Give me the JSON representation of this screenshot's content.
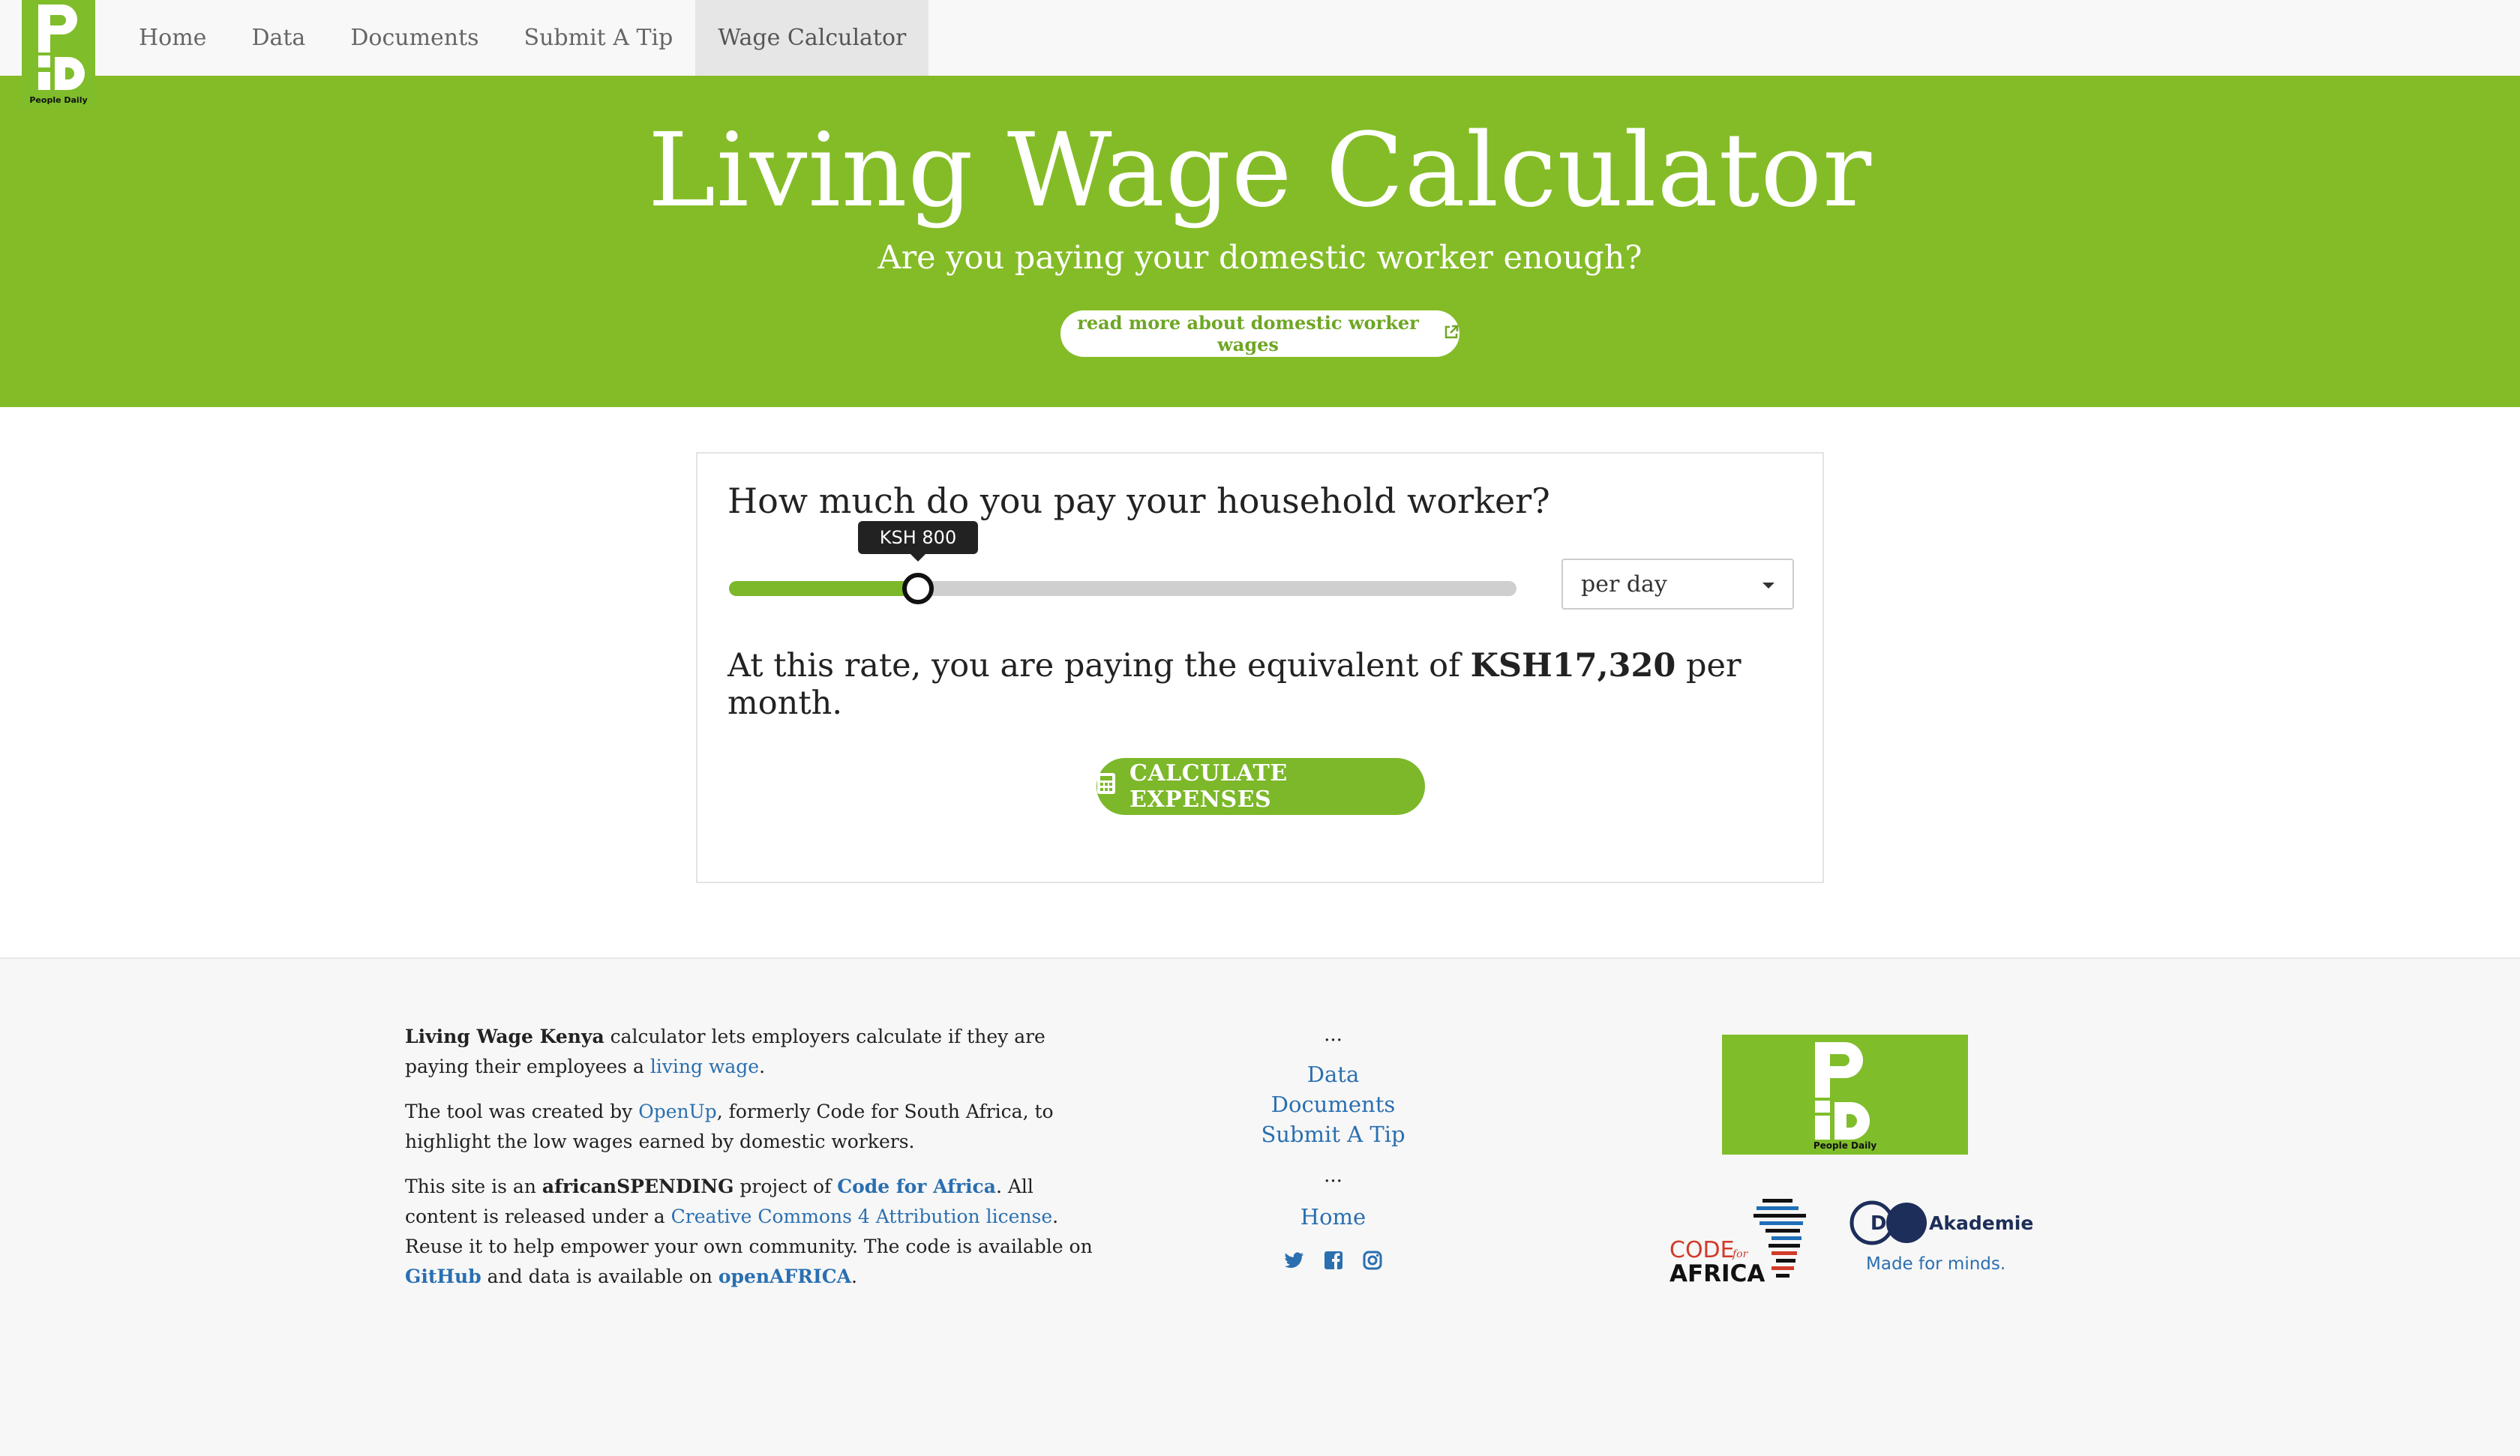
{
  "nav": {
    "logo_text": "People Daily",
    "items": [
      {
        "label": "Home"
      },
      {
        "label": "Data"
      },
      {
        "label": "Documents"
      },
      {
        "label": "Submit A Tip"
      },
      {
        "label": "Wage Calculator",
        "active": true
      }
    ]
  },
  "hero": {
    "title": "Living Wage Calculator",
    "subtitle": "Are you paying your domestic worker enough?",
    "read_more_label": "read more about domestic worker wages"
  },
  "calculator": {
    "question": "How much do you pay your household worker?",
    "slider": {
      "tooltip": "KSH 800",
      "fraction": 0.24
    },
    "period_select": {
      "selected": "per day"
    },
    "equiv_prefix": "At this rate, you are paying the equivalent of ",
    "equiv_amount": "KSH17,320",
    "equiv_suffix": " per month.",
    "calculate_label": "CALCULATE EXPENSES"
  },
  "footer": {
    "p1_bold": "Living Wage Kenya",
    "p1_text": " calculator lets employers calculate if they are paying their employees a ",
    "p1_link": "living wage",
    "p1_end": ".",
    "p2_text": "The tool was created by ",
    "p2_link": "OpenUp",
    "p2_end": ", formerly Code for South Africa, to highlight the low wages earned by domestic workers.",
    "p3_text1": "This site is an ",
    "p3_bold": "africanSPENDING",
    "p3_text2": " project of ",
    "p3_link1": "Code for Africa",
    "p3_text3": ". All content is released under a ",
    "p3_link2": "Creative Commons 4 Attribution license",
    "p3_text4": ". Reuse it to help empower your own community. The code is available on ",
    "p3_link3": "GitHub",
    "p3_text5": " and data is available on ",
    "p3_link4": "openAFRICA",
    "p3_end": ".",
    "dots": "...",
    "links": [
      "Data",
      "Documents",
      "Submit A Tip"
    ],
    "home": "Home",
    "logo_text": "People Daily",
    "cfa_code": "CODE",
    "cfa_for": "for",
    "cfa_africa": "AFRICA",
    "dw_mark": "DW",
    "dw_name": "Akademie",
    "dw_tagline": "Made for minds."
  },
  "colors": {
    "brand_green": "#84bc27",
    "link_blue": "#2a6fb0"
  }
}
